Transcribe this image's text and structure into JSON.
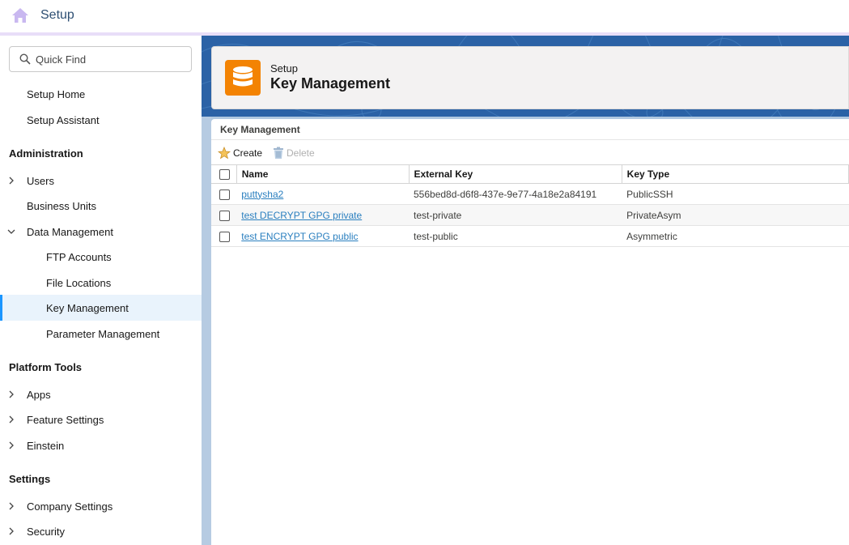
{
  "app": {
    "title": "Setup"
  },
  "sidebar": {
    "quickfind_placeholder": "Quick Find",
    "top_items": [
      {
        "label": "Setup Home"
      },
      {
        "label": "Setup Assistant"
      }
    ],
    "sections": [
      {
        "heading": "Administration",
        "items": [
          {
            "label": "Users",
            "expandable": true,
            "expanded": false
          },
          {
            "label": "Business Units",
            "expandable": false
          },
          {
            "label": "Data Management",
            "expandable": true,
            "expanded": true
          },
          {
            "label": "FTP Accounts",
            "sub": true
          },
          {
            "label": "File Locations",
            "sub": true
          },
          {
            "label": "Key Management",
            "sub": true,
            "selected": true
          },
          {
            "label": "Parameter Management",
            "sub": true
          }
        ]
      },
      {
        "heading": "Platform Tools",
        "items": [
          {
            "label": "Apps",
            "expandable": true
          },
          {
            "label": "Feature Settings",
            "expandable": true
          },
          {
            "label": "Einstein",
            "expandable": true
          }
        ]
      },
      {
        "heading": "Settings",
        "items": [
          {
            "label": "Company Settings",
            "expandable": true
          },
          {
            "label": "Security",
            "expandable": true
          }
        ]
      }
    ]
  },
  "header": {
    "subtitle": "Setup",
    "title": "Key Management",
    "icon": "database-icon",
    "icon_color": "#f38303"
  },
  "content": {
    "title": "Key Management",
    "toolbar": {
      "create_label": "Create",
      "delete_label": "Delete"
    },
    "table": {
      "columns": [
        "Name",
        "External Key",
        "Key Type"
      ],
      "rows": [
        {
          "name": "puttysha2",
          "external_key": "556bed8d-d6f8-437e-9e77-4a18e2a84191",
          "key_type": "PublicSSH"
        },
        {
          "name": "test DECRYPT GPG private",
          "external_key": "test-private",
          "key_type": "PrivateAsym"
        },
        {
          "name": "test ENCRYPT GPG public",
          "external_key": "test-public",
          "key_type": "Asymmetric"
        }
      ]
    }
  },
  "colors": {
    "accent": "#1b96ff",
    "link": "#2a7fbf",
    "banner": "#2b62a6"
  }
}
